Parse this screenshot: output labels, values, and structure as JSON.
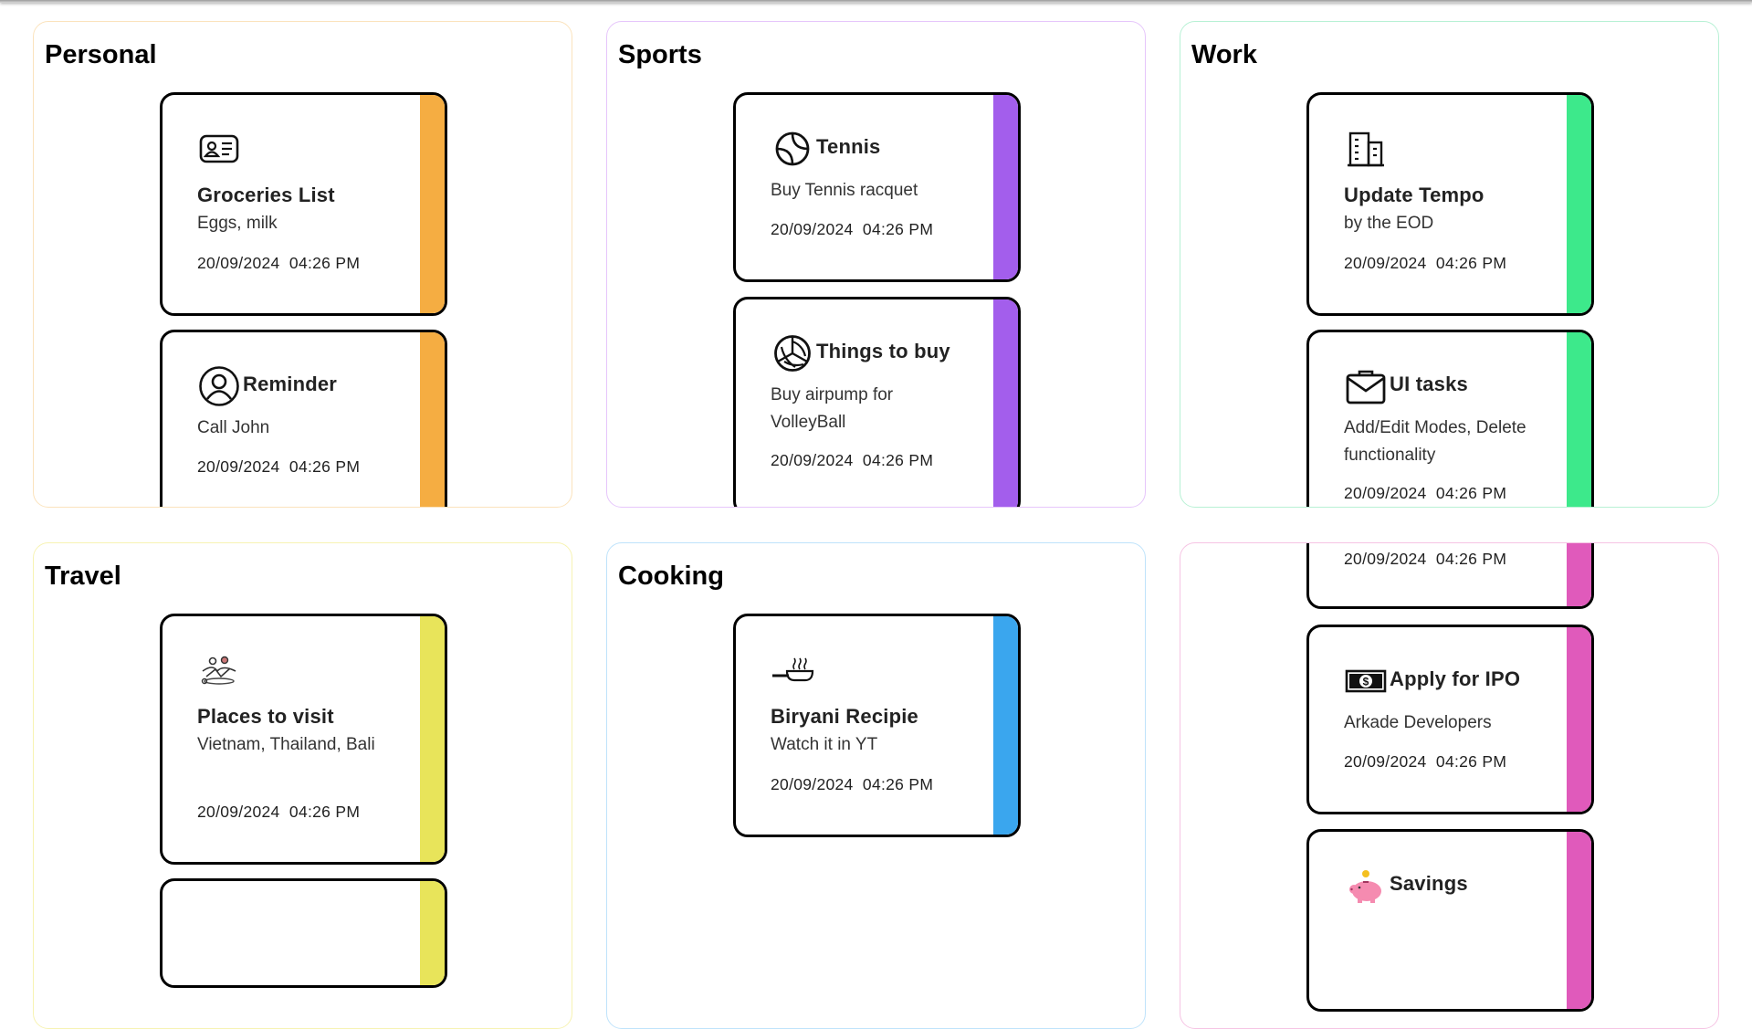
{
  "categories": [
    {
      "name": "Personal",
      "border_color": "#fbe3bd",
      "accent": "#f5ad42",
      "notes": [
        {
          "icon": "id-card-icon",
          "title": "Groceries List",
          "body": "Eggs, milk",
          "date": "20/09/2024",
          "time": "04:26 PM"
        },
        {
          "icon": "user-circle-icon",
          "title": "Reminder",
          "body": "Call John",
          "date": "20/09/2024",
          "time": "04:26 PM"
        }
      ]
    },
    {
      "name": "Sports",
      "border_color": "#e6c6fb",
      "accent": "#a35eec",
      "notes": [
        {
          "icon": "tennis-ball-icon",
          "title": "Tennis",
          "body": "Buy Tennis racquet",
          "date": "20/09/2024",
          "time": "04:26 PM"
        },
        {
          "icon": "volleyball-icon",
          "title": "Things to buy",
          "body": "Buy airpump for VolleyBall",
          "date": "20/09/2024",
          "time": "04:26 PM"
        }
      ]
    },
    {
      "name": "Work",
      "border_color": "#b8f1d5",
      "accent": "#3de98b",
      "notes": [
        {
          "icon": "office-building-icon",
          "title": "Update Tempo",
          "body": "by the EOD",
          "date": "20/09/2024",
          "time": "04:26 PM"
        },
        {
          "icon": "briefcase-icon",
          "title": "UI tasks",
          "body": "Add/Edit Modes, Delete functionality",
          "date": "20/09/2024",
          "time": "04:26 PM"
        }
      ]
    },
    {
      "name": "Travel",
      "border_color": "#f7f3b3",
      "accent": "#e8e45a",
      "notes": [
        {
          "icon": "travelers-icon",
          "title": "Places to visit",
          "body": "Vietnam, Thailand, Bali",
          "date": "20/09/2024",
          "time": "04:26 PM"
        }
      ]
    },
    {
      "name": "Cooking",
      "border_color": "#bfe3fb",
      "accent": "#3aa6ee",
      "notes": [
        {
          "icon": "frying-pan-icon",
          "title": "Biryani Recipie",
          "body": "Watch it in YT",
          "date": "20/09/2024",
          "time": "04:26 PM"
        }
      ]
    },
    {
      "name": "",
      "border_color": "#f6c4e4",
      "accent": "#e05abb",
      "notes": [
        {
          "icon": "",
          "title": "",
          "body": "",
          "date": "20/09/2024",
          "time": "04:26 PM"
        },
        {
          "icon": "banknote-icon",
          "title": "Apply for IPO",
          "body": "Arkade Developers",
          "date": "20/09/2024",
          "time": "04:26 PM"
        },
        {
          "icon": "piggy-bank-icon",
          "title": "Savings",
          "body": "",
          "date": "",
          "time": ""
        }
      ]
    }
  ]
}
